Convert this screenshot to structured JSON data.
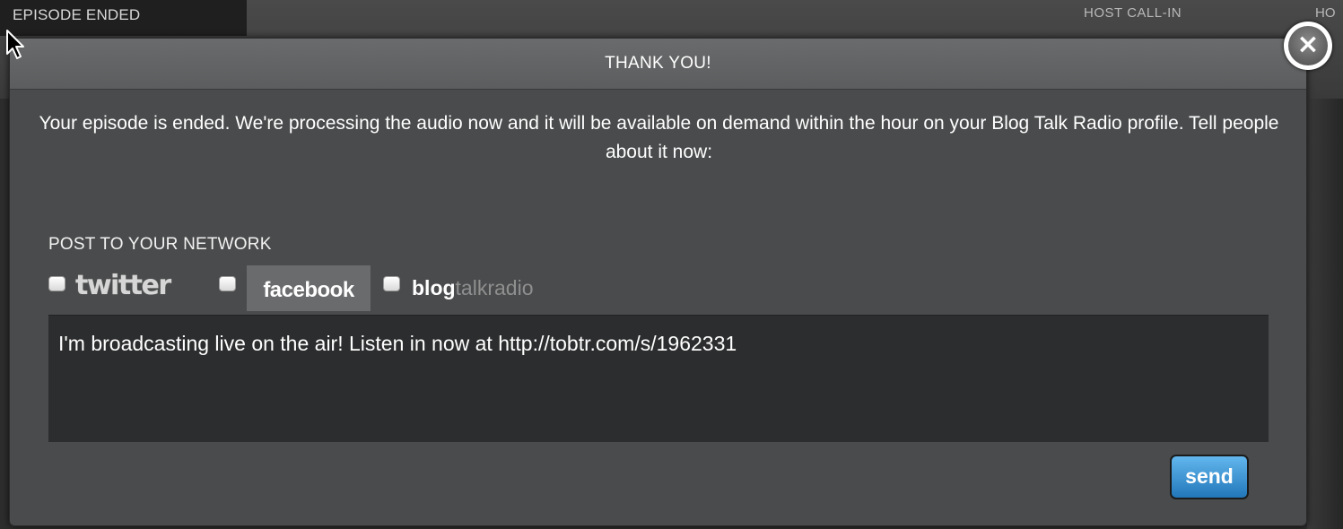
{
  "background": {
    "status": "EPISODE ENDED",
    "host_call_in_label": "HOST CALL-IN",
    "host_label_partial": "HO"
  },
  "dialog": {
    "title": "THANK YOU!",
    "message": "Your episode is ended. We're processing the audio now and it will be available on demand within the hour on your Blog Talk Radio profile. Tell people about it now:",
    "post_label": "POST TO YOUR NETWORK",
    "networks": {
      "twitter": "twitter",
      "facebook": "facebook",
      "blog_a": "blog",
      "blog_b": "talkradio"
    },
    "post_text": "I'm broadcasting live on the air! Listen in now at http://tobtr.com/s/1962331",
    "send_label": "send",
    "close_label": "×"
  },
  "colors": {
    "send_button": "#2b8ad0",
    "modal_bg": "#4a4b4c",
    "textarea_bg": "#2c2d2e"
  },
  "icons": {
    "close": "close-icon",
    "cursor": "mouse-cursor-icon"
  }
}
